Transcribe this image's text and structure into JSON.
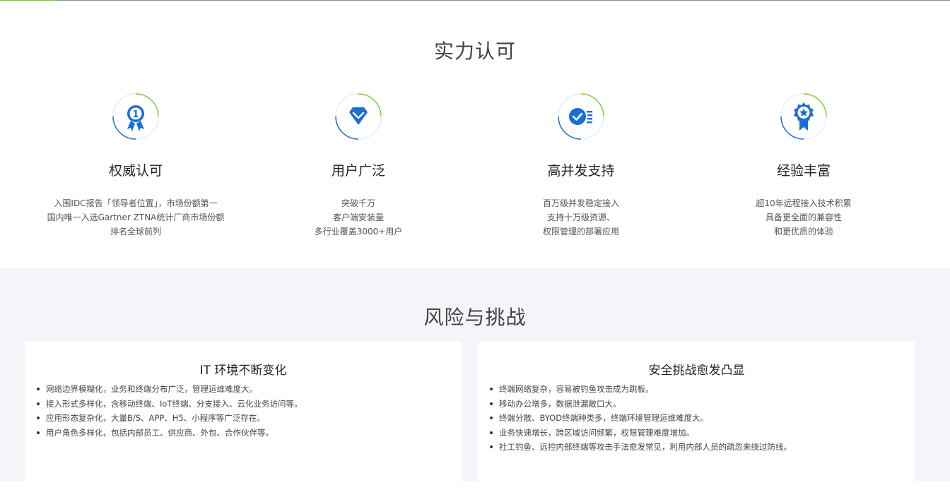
{
  "section_strength": {
    "title": "实力认可",
    "features": [
      {
        "icon": "award-medal-icon",
        "title": "权威认可",
        "lines": [
          "入围IDC报告「领导者位置」，市场份额第一",
          "国内唯一入选Gartner ZTNA统计厂商市场份额",
          "排名全球前列"
        ]
      },
      {
        "icon": "diamond-icon",
        "title": "用户广泛",
        "lines": [
          "突破千万",
          "客户端安装量",
          "多行业覆盖3000+用户"
        ]
      },
      {
        "icon": "check-list-icon",
        "title": "高并发支持",
        "lines": [
          "百万级并发稳定接入",
          "支持十万级资源、",
          "权限管理的部署应用"
        ]
      },
      {
        "icon": "star-badge-icon",
        "title": "经验丰富",
        "lines": [
          "超10年远程接入技术积累",
          "具备更全面的兼容性",
          "和更优质的体验"
        ]
      }
    ]
  },
  "section_risk": {
    "title": "风险与挑战",
    "cards": [
      {
        "title": "IT 环境不断变化",
        "items": [
          "网络边界模糊化，业务和终端分布广泛，管理运维难度大。",
          "接入形式多样化，含移动终端、IoT终端、分支接入、云化业务访问等。",
          "应用形态复杂化，大量B/S、APP、H5、小程序等广泛存在。",
          "用户角色多样化，包括内部员工、供应商、外包、合作伙伴等。"
        ]
      },
      {
        "title": "安全挑战愈发凸显",
        "items": [
          "终端网络复杂，容易被钓鱼攻击成为跳板。",
          "移动办公增多，数据泄漏敞口大。",
          "终端分散、BYOD终端种类多，终端环境管理运维难度大。",
          "业务快速增长，跨区域访问频繁，权限管理难度增加。",
          "社工钓鱼、远控内部终端等攻击手法愈发常见，利用内部人员的疏忽来绕过防线。"
        ]
      }
    ]
  },
  "colors": {
    "brand_blue": "#1a6fd6",
    "accent_green": "#7ccf3b",
    "bg_gray": "#f3f5f8"
  }
}
